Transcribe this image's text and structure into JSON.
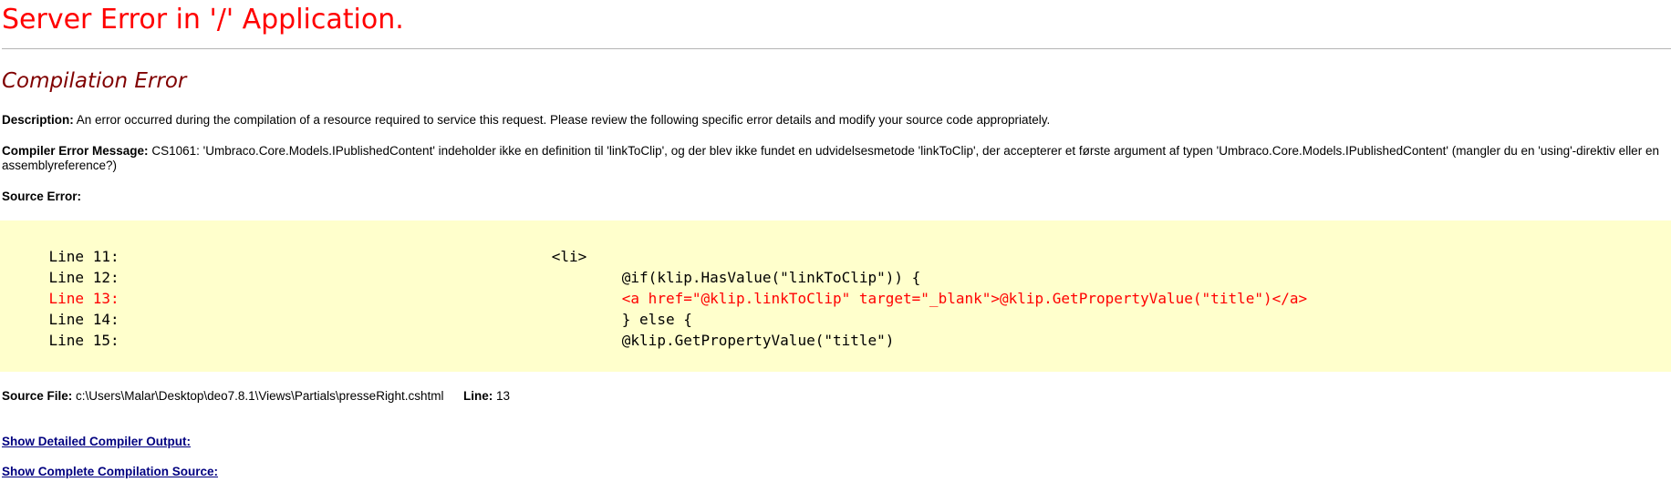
{
  "page": {
    "title": "Server Error in '/' Application.",
    "subtitle": "Compilation Error"
  },
  "description": {
    "label": "Description:",
    "text": "An error occurred during the compilation of a resource required to service this request. Please review the following specific error details and modify your source code appropriately."
  },
  "compiler_error": {
    "label": "Compiler Error Message:",
    "text": "CS1061: 'Umbraco.Core.Models.IPublishedContent' indeholder ikke en definition til 'linkToClip', og der blev ikke fundet en udvidelsesmetode 'linkToClip', der accepterer et første argument af typen 'Umbraco.Core.Models.IPublishedContent' (mangler du en 'using'-direktiv eller en assemblyreference?)"
  },
  "source_error": {
    "label": "Source Error:",
    "lines": [
      {
        "num": "Line 11:",
        "code": "                        <li>",
        "highlight": false
      },
      {
        "num": "Line 12:",
        "code": "                                @if(klip.HasValue(\"linkToClip\")) {",
        "highlight": false
      },
      {
        "num": "Line 13:",
        "code": "                                <a href=\"@klip.linkToClip\" target=\"_blank\">@klip.GetPropertyValue(\"title\")</a>",
        "highlight": true
      },
      {
        "num": "Line 14:",
        "code": "                                } else {",
        "highlight": false
      },
      {
        "num": "Line 15:",
        "code": "                                @klip.GetPropertyValue(\"title\")",
        "highlight": false
      }
    ]
  },
  "source_file": {
    "label": "Source File:",
    "path": "c:\\Users\\Malar\\Desktop\\deo7.8.1\\Views\\Partials\\presseRight.cshtml",
    "line_label": "Line:",
    "line_value": "13"
  },
  "links": {
    "detailed_output": "Show Detailed Compiler Output:",
    "complete_source": "Show Complete Compilation Source:"
  },
  "colors": {
    "title": "#ff0000",
    "subtitle": "#800000",
    "code_background": "#ffffcc",
    "highlight_line": "#ff0000",
    "link": "#000080"
  }
}
